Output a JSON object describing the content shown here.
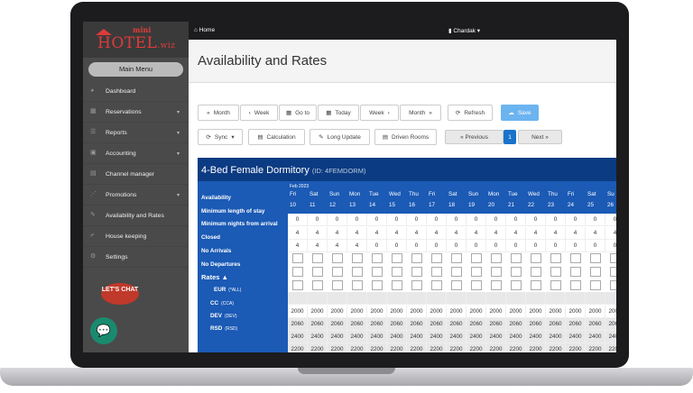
{
  "app": {
    "logo_mini": "mini",
    "logo_main": "HOTEL",
    "logo_suffix": ".wiz"
  },
  "topbar": {
    "home": "Home",
    "user": "Chardak"
  },
  "sidebar": {
    "main_menu": "Main Menu",
    "items": [
      {
        "label": "Dashboard",
        "icon": "dashboard-icon",
        "chevron": false
      },
      {
        "label": "Reservations",
        "icon": "reservations-icon",
        "chevron": true
      },
      {
        "label": "Reports",
        "icon": "reports-icon",
        "chevron": true
      },
      {
        "label": "Accounting",
        "icon": "accounting-icon",
        "chevron": true
      },
      {
        "label": "Channel manager",
        "icon": "channel-icon",
        "chevron": false
      },
      {
        "label": "Promotions",
        "icon": "promotions-icon",
        "chevron": true
      },
      {
        "label": "Availability and Rates",
        "icon": "wrench-icon",
        "chevron": false
      },
      {
        "label": "House keeping",
        "icon": "broom-icon",
        "chevron": false
      },
      {
        "label": "Settings",
        "icon": "gear-icon",
        "chevron": false
      }
    ],
    "chat_label": "LET'S CHAT"
  },
  "page": {
    "title": "Availability and Rates"
  },
  "toolbar": {
    "prev_month": "Month",
    "prev_week": "Week",
    "goto": "Go to",
    "today": "Today",
    "next_week": "Week",
    "next_month": "Month",
    "refresh": "Refresh",
    "save": "Save",
    "sync": "Sync",
    "calculation": "Calculation",
    "long_update": "Long Update",
    "driven_rooms": "Driven Rooms",
    "previous": "« Previous",
    "page": "1",
    "next": "Next »"
  },
  "grid": {
    "room_name": "4-Bed Female Dormitory",
    "room_id": "(ID: 4FEMDORM)",
    "month": "Feb 2023",
    "days": [
      {
        "n": "Fri",
        "d": "10"
      },
      {
        "n": "Sat",
        "d": "11"
      },
      {
        "n": "Sun",
        "d": "12"
      },
      {
        "n": "Mon",
        "d": "13"
      },
      {
        "n": "Tue",
        "d": "14"
      },
      {
        "n": "Wed",
        "d": "15"
      },
      {
        "n": "Thu",
        "d": "16"
      },
      {
        "n": "Fri",
        "d": "17"
      },
      {
        "n": "Sat",
        "d": "18"
      },
      {
        "n": "Sun",
        "d": "19"
      },
      {
        "n": "Mon",
        "d": "20"
      },
      {
        "n": "Tue",
        "d": "21"
      },
      {
        "n": "Wed",
        "d": "22"
      },
      {
        "n": "Thu",
        "d": "23"
      },
      {
        "n": "Fri",
        "d": "24"
      },
      {
        "n": "Sat",
        "d": "25"
      },
      {
        "n": "Su",
        "d": "26"
      }
    ],
    "rows": {
      "availability": "Availability",
      "min_stay": "Minimum length of stay",
      "min_arrival": "Minimum nights from arrival",
      "closed": "Closed",
      "no_arrivals": "No Arrivals",
      "no_departures": "No Departures",
      "rates": "Rates ▲",
      "eur": "EUR",
      "eur_sub": "(*ALL)",
      "cc": "CC",
      "cc_sub": "(CCA)",
      "dev": "DEV",
      "dev_sub": "(DEV)",
      "rsd": "RSD",
      "rsd_sub": "(RSD)"
    },
    "values": {
      "availability": "0",
      "min_stay": "4",
      "min_arrival": "4",
      "min_arrival_alt": "0",
      "eur": "2000",
      "cc": "2060",
      "dev": "2400",
      "rsd": "2200"
    }
  }
}
